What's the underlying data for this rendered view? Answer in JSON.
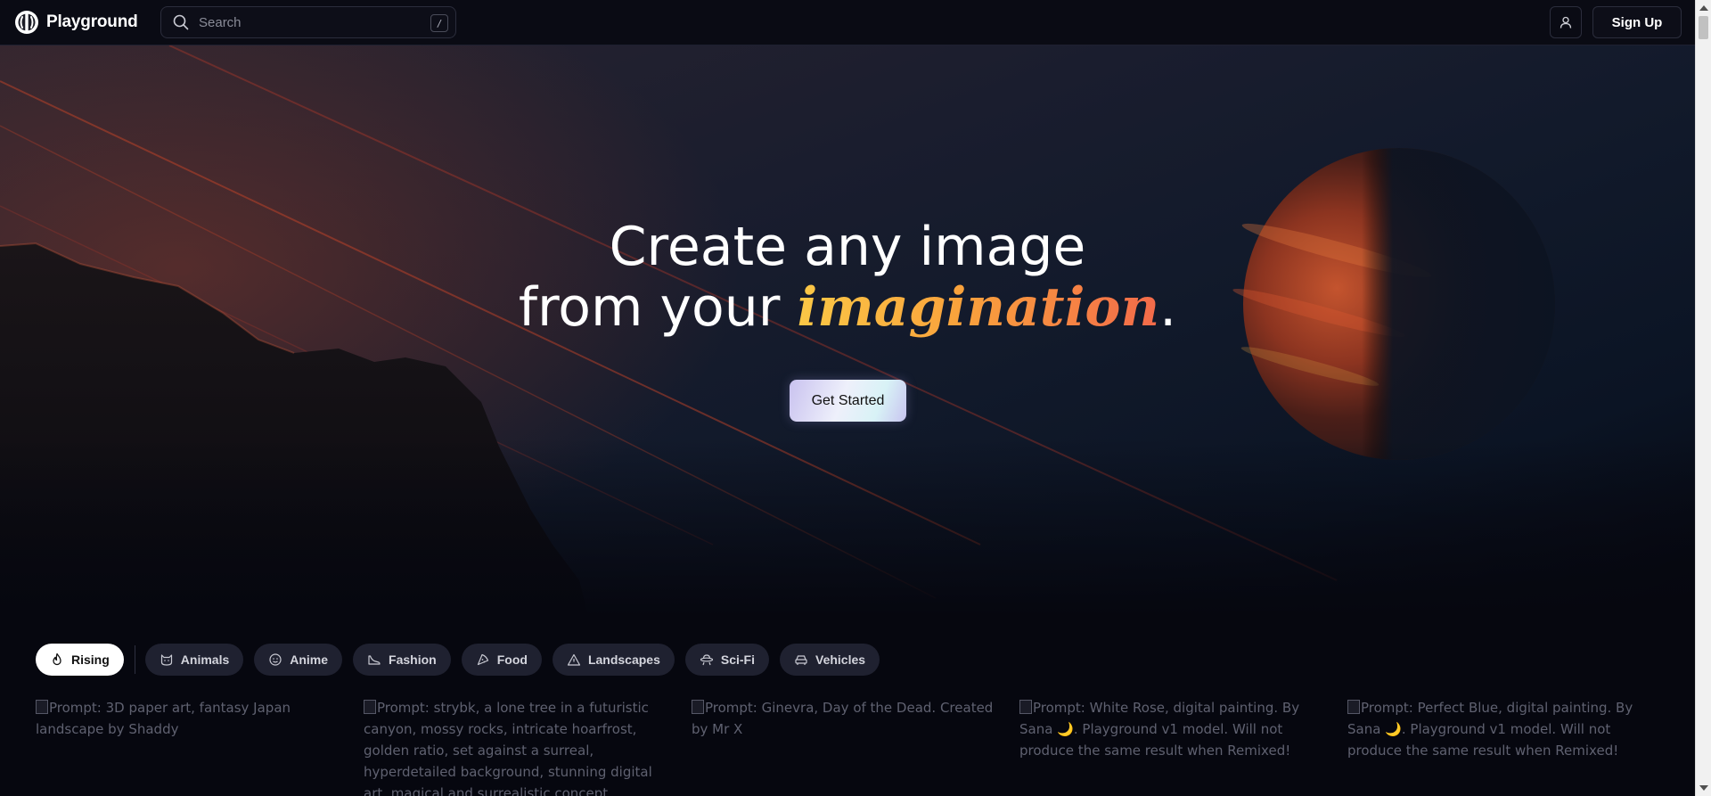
{
  "header": {
    "logo_text": "Playground",
    "search_placeholder": "Search",
    "search_shortcut": "/",
    "signup_label": "Sign Up"
  },
  "hero": {
    "line1": "Create any image",
    "line2_prefix": "from your ",
    "line2_accent": "imagination",
    "line2_suffix": ".",
    "cta_label": "Get Started",
    "accent_colors": [
      "#fbc846",
      "#f36a4a"
    ]
  },
  "categories": [
    {
      "label": "Rising",
      "icon": "flame-icon",
      "active": true
    },
    {
      "label": "Animals",
      "icon": "cat-icon",
      "active": false
    },
    {
      "label": "Anime",
      "icon": "smiley-icon",
      "active": false
    },
    {
      "label": "Fashion",
      "icon": "shoe-icon",
      "active": false
    },
    {
      "label": "Food",
      "icon": "pizza-icon",
      "active": false
    },
    {
      "label": "Landscapes",
      "icon": "mountain-icon",
      "active": false
    },
    {
      "label": "Sci-Fi",
      "icon": "ufo-icon",
      "active": false
    },
    {
      "label": "Vehicles",
      "icon": "car-icon",
      "active": false
    }
  ],
  "gallery": [
    {
      "alt": "Prompt: 3D paper art, fantasy Japan landscape by Shaddy"
    },
    {
      "alt": "Prompt: strybk, a lone tree in a futuristic canyon, mossy rocks, intricate hoarfrost, golden ratio, set against a surreal, hyperdetailed background, stunning digital art, magical and surrealistic concept masterpiece, oil painting and"
    },
    {
      "alt": "Prompt: Ginevra, Day of the Dead. Created by Mr X"
    },
    {
      "alt": "Prompt: White Rose, digital painting. By Sana 🌙. Playground v1 model. Will not produce the same result when Remixed!"
    },
    {
      "alt": "Prompt: Perfect Blue, digital painting. By Sana 🌙. Playground v1 model. Will not produce the same result when Remixed!"
    }
  ]
}
